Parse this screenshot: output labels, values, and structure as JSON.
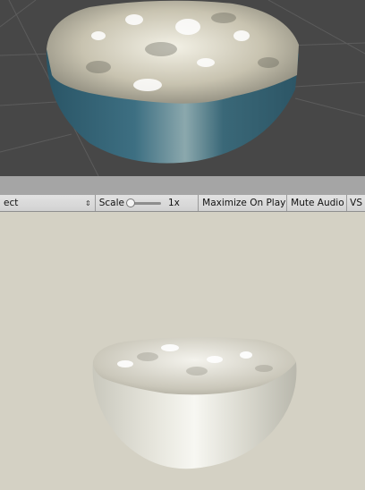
{
  "scene": {
    "background": "#474747"
  },
  "toolbar": {
    "aspect_label": "ect",
    "aspect_dropdown_icon": "dropdown-arrows-icon",
    "scale_label": "Scale",
    "scale_value": "1x",
    "maximize_label": "Maximize On Play",
    "mute_label": "Mute Audio",
    "vsync_label": "VS"
  },
  "game": {
    "background": "#d4d1c4"
  }
}
